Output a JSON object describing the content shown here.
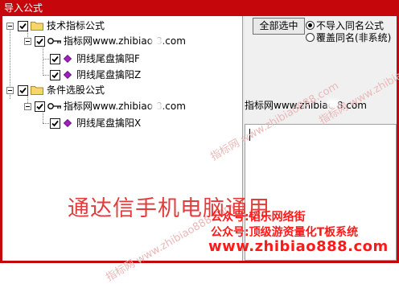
{
  "dialog": {
    "title": "导入公式"
  },
  "tree": {
    "groups": [
      {
        "label": "技术指标公式",
        "source": "指标网www.zhibiao  8.com",
        "items": [
          "阴线尾盘擒阳F",
          "阴线尾盘擒阳Z"
        ]
      },
      {
        "label": "条件选股公式",
        "source": "指标网www.zhibiao  8.com",
        "items": [
          "阴线尾盘擒阳X"
        ]
      }
    ]
  },
  "panel": {
    "select_all_label": "全部选中",
    "options": [
      {
        "label": "不导入同名公式",
        "selected": true
      },
      {
        "label": "覆盖同名(非系统)",
        "selected": false
      }
    ],
    "info_text": "指标网www.zhibiao  8.com"
  },
  "watermark": {
    "overlay_text": "通达信手机电脑通用",
    "line1": "公众号:韬乐网络街",
    "line2": "公众号:顶级游资量化T板系统",
    "url": "www.zhibiao888.com",
    "faint": "指标网 www.zhibiao888.com"
  },
  "colors": {
    "titlebar": "#c5060a",
    "overlay": "#e23c3c",
    "promo": "#ff1a1a"
  }
}
